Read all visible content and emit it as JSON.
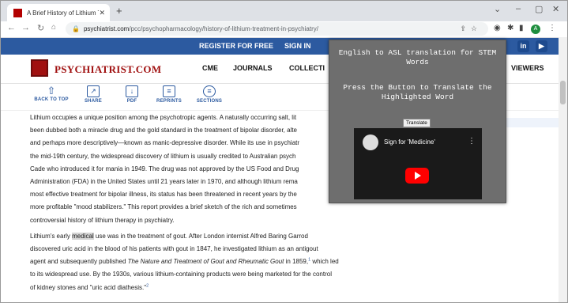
{
  "browser": {
    "tab_title": "A Brief History of Lithium Treatm",
    "url_host": "psychiatrist.com",
    "url_path": "/pcc/psychopharmacology/history-of-lithium-treatment-in-psychiatry/",
    "profile_initial": "A"
  },
  "site": {
    "register": "REGISTER FOR FREE",
    "signin": "SIGN IN",
    "logo": "PSYCHIATRIST.COM",
    "nav": [
      "CME",
      "JOURNALS",
      "COLLECTI",
      "VIEWERS"
    ],
    "social": [
      "in",
      "▶"
    ]
  },
  "actions": [
    {
      "label": "BACK TO TOP",
      "icon": "arrow-up-icon"
    },
    {
      "label": "SHARE",
      "icon": "share-icon"
    },
    {
      "label": "PDF",
      "icon": "pdf-icon"
    },
    {
      "label": "REPRINTS",
      "icon": "reprints-icon"
    },
    {
      "label": "SECTIONS",
      "icon": "sections-icon"
    }
  ],
  "article": {
    "p1": [
      "Lithium occupies a unique position among the psychotropic agents. A naturally occurring salt, lit",
      "been dubbed both a miracle drug and the gold standard in the treatment of bipolar disorder, alte",
      "and perhaps more descriptively—known as manic-depressive disorder. While its use in psychiatr",
      "the mid-19th century, the widespread discovery of lithium is usually credited to Australian psych",
      "Cade who introduced it for mania in 1949. The drug was not approved by the US Food and Drug",
      "Administration (FDA) in the United States until 21 years later in 1970, and although lithium rema",
      "most effective treatment for bipolar illness, its status has been threatened in recent years by the",
      "more profitable \"mood stabilizers.\" This report provides a brief sketch of the rich and sometimes",
      "controversial history of lithium therapy in psychiatry."
    ],
    "p2_line1_pre": "Lithium's early ",
    "p2_highlight": "medical",
    "p2_line1_post": " use was in the treatment of gout. After London internist Alfred Baring Garrod",
    "p2_line2": "discovered uric acid in the blood of his patients with gout in 1847, he investigated lithium as an antigout",
    "p2_line3_pre": "agent and subsequently published ",
    "p2_line3_italic": "The Nature and Treatment of Gout and Rheumatic Gout",
    "p2_line3_post": " in 1859,",
    "p2_sup1": "1",
    "p2_line3_end": " which led",
    "p2_line4": "to its widespread use. By the 1930s, various lithium-containing products were being marketed for the control",
    "p2_line5": "of kidney stones and \"uric acid diathesis.\"",
    "p2_sup2": "2"
  },
  "popup": {
    "title": "English to ASL translation for STEM Words",
    "subtitle": "Press the Button to Translate the Highlighted Word",
    "button": "Translate",
    "video_title": "Sign for 'Medicine'"
  }
}
